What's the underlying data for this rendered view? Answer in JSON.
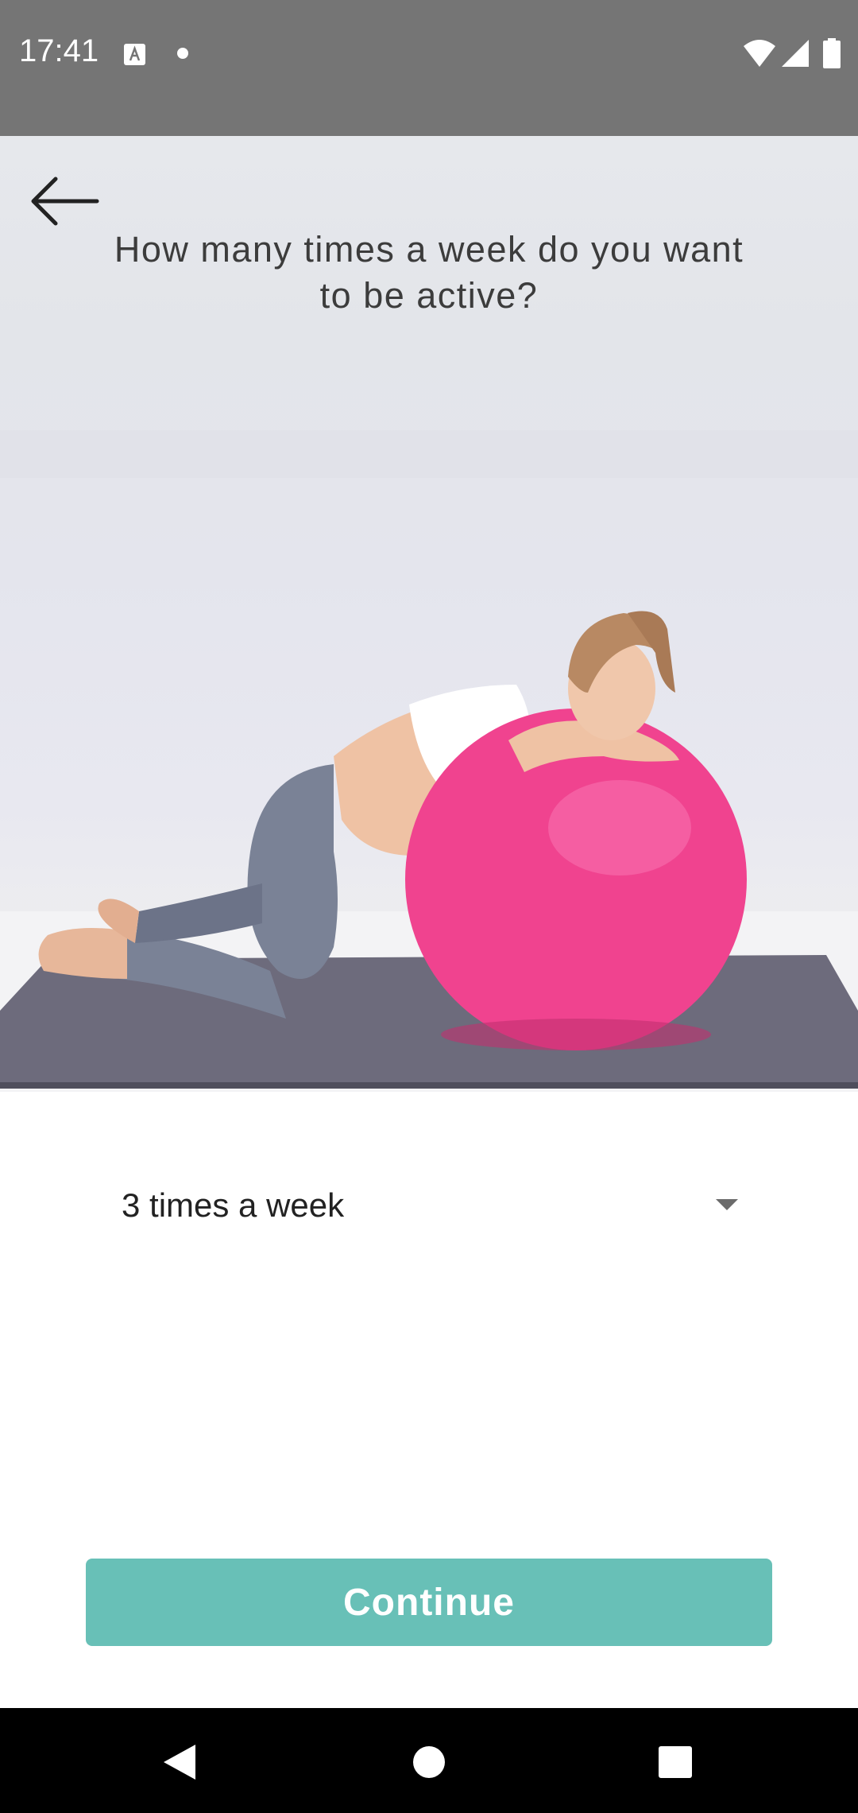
{
  "status_bar": {
    "time": "17:41",
    "icons": [
      "text-a-icon",
      "notification-dot-icon",
      "wifi-icon",
      "signal-icon",
      "battery-icon"
    ]
  },
  "header": {
    "back_icon": "arrow-left-icon",
    "question": "How many times a week do you want to be active?"
  },
  "hero_image": {
    "subject": "photo-pregnant-woman-exercise-ball"
  },
  "dropdown": {
    "selected_value": "3 times a week",
    "arrow_icon": "triangle-down-icon"
  },
  "actions": {
    "continue_label": "Continue",
    "continue_color": "#68c0b7"
  },
  "nav_bar": {
    "icons": [
      "nav-back-icon",
      "nav-home-icon",
      "nav-recents-icon"
    ]
  },
  "colors": {
    "status_bar": "#757575",
    "accent": "#68c0b7",
    "ball": "#f0438f"
  }
}
